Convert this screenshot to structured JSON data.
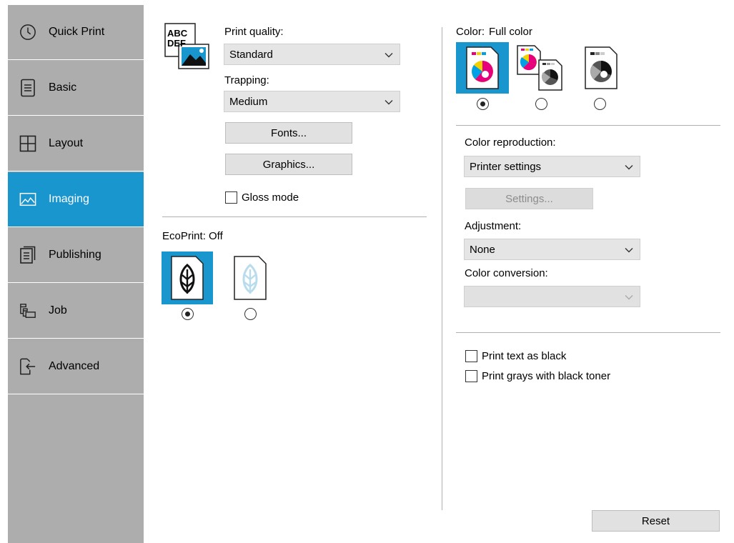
{
  "sidebar": {
    "items": [
      {
        "label": "Quick Print",
        "icon": "clock-icon",
        "active": false
      },
      {
        "label": "Basic",
        "icon": "document-icon",
        "active": false
      },
      {
        "label": "Layout",
        "icon": "layout-grid-icon",
        "active": false
      },
      {
        "label": "Imaging",
        "icon": "image-icon",
        "active": true
      },
      {
        "label": "Publishing",
        "icon": "publishing-icon",
        "active": false
      },
      {
        "label": "Job",
        "icon": "job-stack-icon",
        "active": false
      },
      {
        "label": "Advanced",
        "icon": "advanced-arrow-icon",
        "active": false
      }
    ],
    "accent_color": "#1a96cf"
  },
  "quality": {
    "icon_text_line1": "ABC",
    "icon_text_line2": "DEF",
    "print_quality_label": "Print quality:",
    "print_quality_value": "Standard",
    "trapping_label": "Trapping:",
    "trapping_value": "Medium",
    "fonts_button": "Fonts...",
    "graphics_button": "Graphics...",
    "gloss_mode_label": "Gloss mode",
    "gloss_mode_checked": false
  },
  "ecoprint": {
    "label": "EcoPrint:",
    "value": "Off",
    "options": [
      {
        "icon": "ecoprint-off-leaf-icon",
        "selected": true
      },
      {
        "icon": "ecoprint-on-leaf-icon",
        "selected": false
      }
    ]
  },
  "color": {
    "label": "Color:",
    "value": "Full color",
    "options": [
      {
        "icon": "full-color-icon",
        "selected": true
      },
      {
        "icon": "auto-color-icon",
        "selected": false
      },
      {
        "icon": "black-white-icon",
        "selected": false
      }
    ],
    "reproduction_label": "Color reproduction:",
    "reproduction_value": "Printer settings",
    "settings_button": "Settings...",
    "adjustment_label": "Adjustment:",
    "adjustment_value": "None",
    "conversion_label": "Color conversion:",
    "conversion_value": "",
    "print_text_black_label": "Print text as black",
    "print_text_black_checked": false,
    "print_grays_label": "Print grays with black toner",
    "print_grays_checked": false
  },
  "footer": {
    "reset_button": "Reset"
  }
}
